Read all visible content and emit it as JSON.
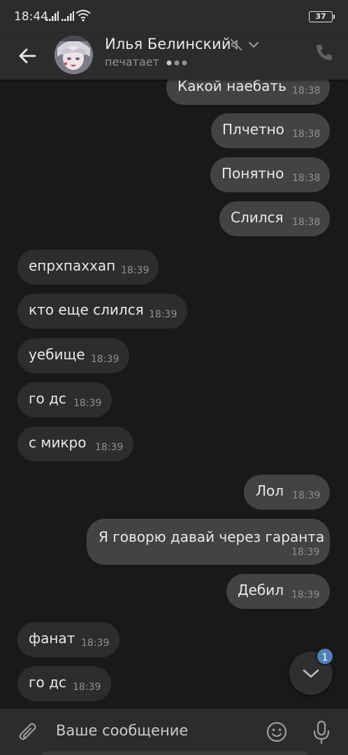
{
  "status_bar": {
    "time": "18:44",
    "battery": "37"
  },
  "header": {
    "contact_name": "Илья Белинский",
    "status": "печатает",
    "icons": [
      "back-arrow-icon",
      "mute-icon",
      "chevron-down-icon",
      "phone-icon"
    ]
  },
  "messages": [
    {
      "direction": "outgoing",
      "text": "Какой наебать",
      "time": "18:38"
    },
    {
      "direction": "outgoing",
      "text": "Плчетно",
      "time": "18:38"
    },
    {
      "direction": "outgoing",
      "text": "Понятно",
      "time": "18:38"
    },
    {
      "direction": "outgoing",
      "text": "Слился",
      "time": "18:38"
    },
    {
      "direction": "incoming",
      "text": "епрхпаххап",
      "time": "18:39"
    },
    {
      "direction": "incoming",
      "text": "кто еще слился",
      "time": "18:39"
    },
    {
      "direction": "incoming",
      "text": "уебище",
      "time": "18:39"
    },
    {
      "direction": "incoming",
      "text": "го дс",
      "time": "18:39"
    },
    {
      "direction": "incoming",
      "text": "с микро",
      "time": "18:39"
    },
    {
      "direction": "outgoing",
      "text": "Лол",
      "time": "18:39"
    },
    {
      "direction": "outgoing",
      "text": "Я говорю давай через гаранта",
      "time": "18:39"
    },
    {
      "direction": "outgoing",
      "text": "Дебил",
      "time": "18:39"
    },
    {
      "direction": "incoming",
      "text": "фанат",
      "time": "18:39"
    },
    {
      "direction": "incoming",
      "text": "го дс",
      "time": "18:39"
    }
  ],
  "scroll_down": {
    "unread_count": "1"
  },
  "composer": {
    "placeholder": "Ваше сообщение",
    "icons": [
      "paperclip-icon",
      "smiley-icon",
      "microphone-icon"
    ]
  },
  "colors": {
    "background": "#191919",
    "bar": "#2c2c2c",
    "incoming_bubble": "#2d2d2d",
    "outgoing_bubble": "#434343",
    "accent": "#5181b8"
  }
}
